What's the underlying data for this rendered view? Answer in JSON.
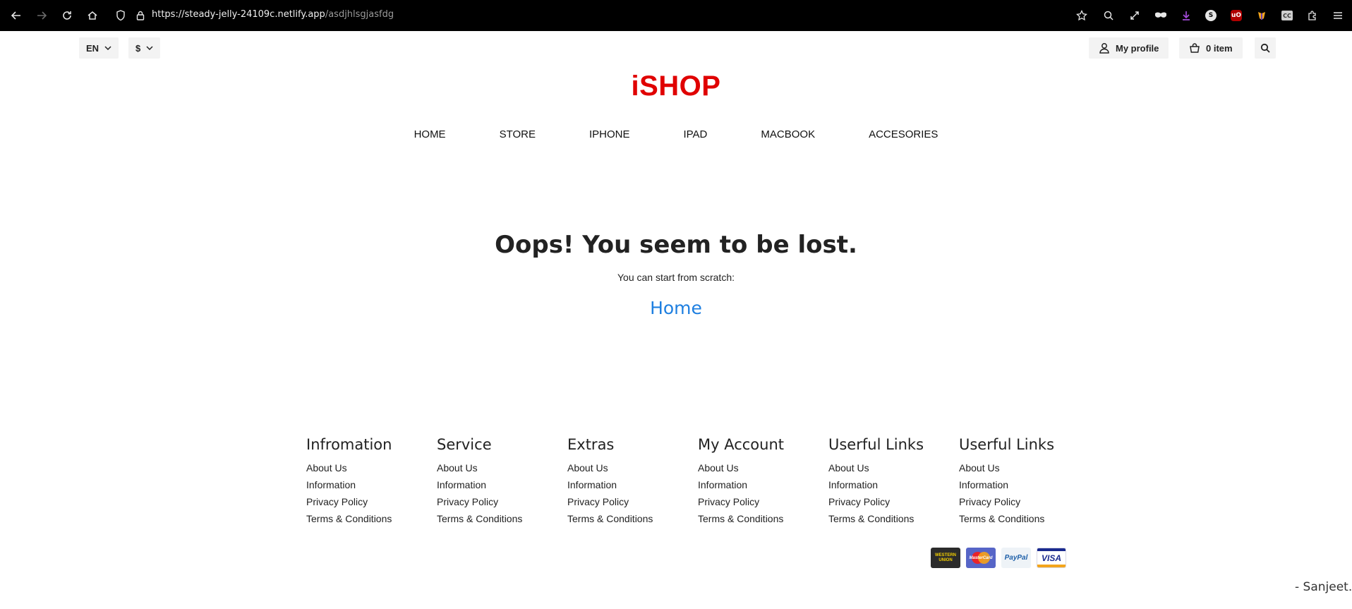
{
  "browser": {
    "url_host": "https://steady-jelly-24109c.netlify.app",
    "url_path": "/asdjhlsgjasfdg"
  },
  "topbar": {
    "language": "EN",
    "currency": "$",
    "profile_label": "My profile",
    "cart_label": "0 item"
  },
  "brand": {
    "logo": "iSHOP",
    "logo_color": "#e00000"
  },
  "nav": {
    "items": [
      "HOME",
      "STORE",
      "IPHONE",
      "IPAD",
      "MACBOOK",
      "ACCESORIES"
    ]
  },
  "not_found": {
    "title": "Oops! You seem to be lost.",
    "subtitle": "You can start from scratch:",
    "home_link": "Home",
    "link_color": "#1e7fe0"
  },
  "footer": {
    "columns": [
      {
        "title": "Infromation",
        "links": [
          "About Us",
          "Information",
          "Privacy Policy",
          "Terms & Conditions"
        ]
      },
      {
        "title": "Service",
        "links": [
          "About Us",
          "Information",
          "Privacy Policy",
          "Terms & Conditions"
        ]
      },
      {
        "title": "Extras",
        "links": [
          "About Us",
          "Information",
          "Privacy Policy",
          "Terms & Conditions"
        ]
      },
      {
        "title": "My Account",
        "links": [
          "About Us",
          "Information",
          "Privacy Policy",
          "Terms & Conditions"
        ]
      },
      {
        "title": "Userful Links",
        "links": [
          "About Us",
          "Information",
          "Privacy Policy",
          "Terms & Conditions"
        ]
      },
      {
        "title": "Userful Links",
        "links": [
          "About Us",
          "Information",
          "Privacy Policy",
          "Terms & Conditions"
        ]
      }
    ],
    "payments": {
      "western_union_line1": "WESTERN",
      "western_union_line2": "UNION",
      "mastercard": "MasterCard",
      "paypal": "PayPal",
      "visa": "VISA"
    },
    "credit": "- Sanjeet.."
  }
}
